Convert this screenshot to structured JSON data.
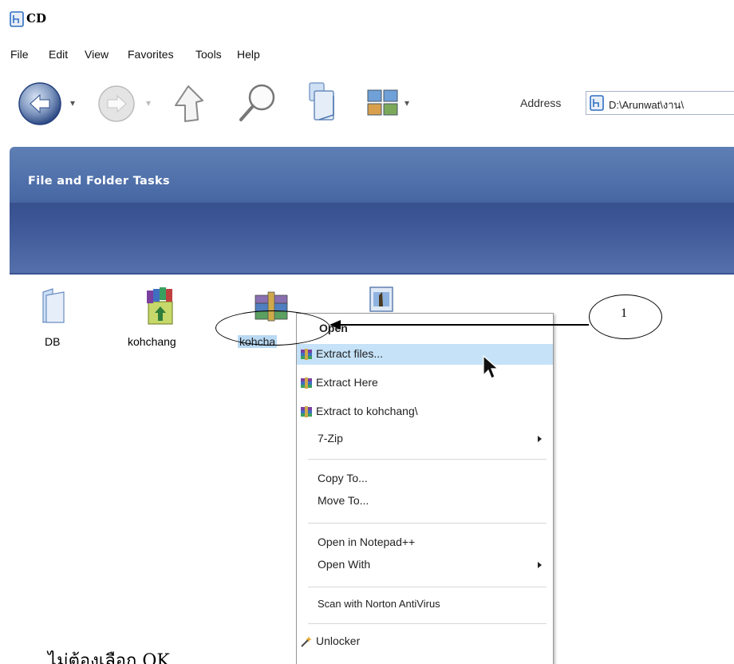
{
  "window": {
    "title": "CD"
  },
  "menu": {
    "items": [
      {
        "label": "File"
      },
      {
        "label": "Edit"
      },
      {
        "label": "View"
      },
      {
        "label": "Favorites"
      },
      {
        "label": "Tools"
      },
      {
        "label": "Help"
      }
    ]
  },
  "toolbar": {
    "back_icon": "back-arrow-icon",
    "forward_icon": "forward-arrow-icon",
    "up_icon": "up-folder-icon",
    "search_icon": "search-icon",
    "folders_icon": "folders-icon",
    "views_icon": "views-icon"
  },
  "address": {
    "label": "Address",
    "value": "D:\\Arunwat\\งาน\\"
  },
  "pane": {
    "title": "File and Folder Tasks"
  },
  "files": [
    {
      "label": "DB",
      "icon": "folder-icon"
    },
    {
      "label": "kohchang",
      "icon": "winrar-archive-icon"
    },
    {
      "label": "kohcha",
      "icon": "winrar-archive-icon"
    },
    {
      "label": "",
      "icon": "image-file-icon"
    }
  ],
  "context_menu": {
    "items": [
      {
        "label": "Open"
      },
      {
        "label": "Extract files..."
      },
      {
        "label": "Extract Here"
      },
      {
        "label": "Extract to kohchang\\"
      },
      {
        "label": "7-Zip"
      },
      {
        "label": "Copy To..."
      },
      {
        "label": "Move To..."
      },
      {
        "label": "Open in Notepad++"
      },
      {
        "label": "Open With"
      },
      {
        "label": "Scan with Norton AntiVirus"
      },
      {
        "label": "Unlocker"
      }
    ]
  },
  "annotation": {
    "number": "1"
  },
  "caption": {
    "text": "ไม่ต้องเลือก OK"
  },
  "colors": {
    "pane_blue": "#3b5593",
    "highlight": "#c5e2f8",
    "selection": "#b8d9f3"
  }
}
